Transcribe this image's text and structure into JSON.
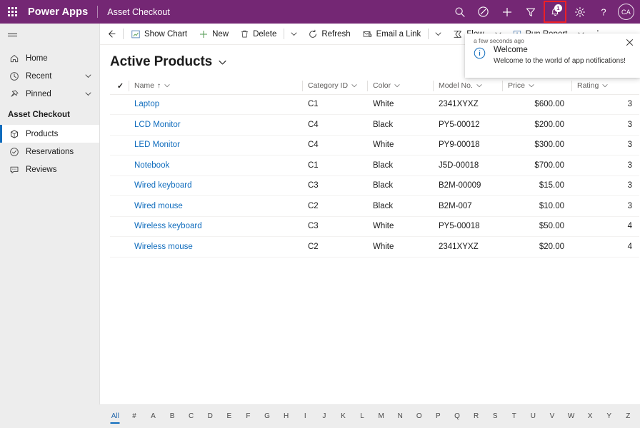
{
  "header": {
    "waffle_label": "app-launcher",
    "brand": "Power Apps",
    "app_name": "Asset Checkout",
    "brand_color": "#742774",
    "highlight_color": "#ec2027",
    "actions": [
      {
        "name": "search-icon",
        "label": "Search"
      },
      {
        "name": "diagnostics-icon",
        "label": "Diagnostics"
      },
      {
        "name": "plus-icon",
        "label": "New"
      },
      {
        "name": "filter-icon",
        "label": "Filter"
      },
      {
        "name": "notifications-icon",
        "label": "Notifications",
        "badge": "1",
        "highlighted": true
      },
      {
        "name": "settings-gear-icon",
        "label": "Settings"
      },
      {
        "name": "help-icon",
        "label": "Help"
      }
    ],
    "avatar_initials": "CA"
  },
  "sidebar": {
    "hamburger_label": "Site map",
    "top_items": [
      {
        "label": "Home",
        "icon": "home-icon",
        "chevron": false
      },
      {
        "label": "Recent",
        "icon": "clock-icon",
        "chevron": true
      },
      {
        "label": "Pinned",
        "icon": "pin-icon",
        "chevron": true
      }
    ],
    "group_title": "Asset Checkout",
    "entity_items": [
      {
        "label": "Products",
        "icon": "box-icon",
        "selected": true
      },
      {
        "label": "Reservations",
        "icon": "check-circle-icon",
        "selected": false
      },
      {
        "label": "Reviews",
        "icon": "comment-icon",
        "selected": false
      }
    ]
  },
  "command_bar": {
    "back_label": "Back",
    "commands": [
      {
        "label": "Show Chart",
        "icon": "chart-icon",
        "caret": false
      },
      {
        "label": "New",
        "icon": "plus-icon",
        "caret": false
      },
      {
        "label": "Delete",
        "icon": "trash-icon",
        "caret": true
      },
      {
        "label": "Refresh",
        "icon": "refresh-icon",
        "caret": false
      },
      {
        "label": "Email a Link",
        "icon": "email-link-icon",
        "caret": true
      },
      {
        "label": "Flow",
        "icon": "flow-icon",
        "caret": true
      },
      {
        "label": "Run Report",
        "icon": "report-icon",
        "caret": true
      }
    ],
    "overflow_label": "More commands"
  },
  "notification": {
    "time": "a few seconds ago",
    "close_label": "Close",
    "icon": "info-circle-icon",
    "title": "Welcome",
    "message": "Welcome to the world of app notifications!"
  },
  "view": {
    "title": "Active Products",
    "caret_label": "Change view"
  },
  "grid": {
    "select_all_glyph": "✓",
    "columns": [
      {
        "key": "name",
        "label": "Name",
        "sorted": true,
        "sort_glyph": "↑",
        "align": "left"
      },
      {
        "key": "category",
        "label": "Category ID",
        "align": "left"
      },
      {
        "key": "color",
        "label": "Color",
        "align": "left"
      },
      {
        "key": "model",
        "label": "Model No.",
        "align": "left"
      },
      {
        "key": "price",
        "label": "Price",
        "align": "right"
      },
      {
        "key": "rating",
        "label": "Rating",
        "align": "right"
      }
    ],
    "rows": [
      {
        "name": "Laptop",
        "category": "C1",
        "color": "White",
        "model": "2341XYXZ",
        "price": "$600.00",
        "rating": "3"
      },
      {
        "name": "LCD Monitor",
        "category": "C4",
        "color": "Black",
        "model": "PY5-00012",
        "price": "$200.00",
        "rating": "3"
      },
      {
        "name": "LED Monitor",
        "category": "C4",
        "color": "White",
        "model": "PY9-00018",
        "price": "$300.00",
        "rating": "3"
      },
      {
        "name": "Notebook",
        "category": "C1",
        "color": "Black",
        "model": "J5D-00018",
        "price": "$700.00",
        "rating": "3"
      },
      {
        "name": "Wired keyboard",
        "category": "C3",
        "color": "Black",
        "model": "B2M-00009",
        "price": "$15.00",
        "rating": "3"
      },
      {
        "name": "Wired mouse",
        "category": "C2",
        "color": "Black",
        "model": "B2M-007",
        "price": "$10.00",
        "rating": "3"
      },
      {
        "name": "Wireless keyboard",
        "category": "C3",
        "color": "White",
        "model": "PY5-00018",
        "price": "$50.00",
        "rating": "4"
      },
      {
        "name": "Wireless mouse",
        "category": "C2",
        "color": "White",
        "model": "2341XYXZ",
        "price": "$20.00",
        "rating": "4"
      }
    ]
  },
  "alpha_filter": {
    "active": "All",
    "items": [
      "All",
      "#",
      "A",
      "B",
      "C",
      "D",
      "E",
      "F",
      "G",
      "H",
      "I",
      "J",
      "K",
      "L",
      "M",
      "N",
      "O",
      "P",
      "Q",
      "R",
      "S",
      "T",
      "U",
      "V",
      "W",
      "X",
      "Y",
      "Z"
    ]
  }
}
